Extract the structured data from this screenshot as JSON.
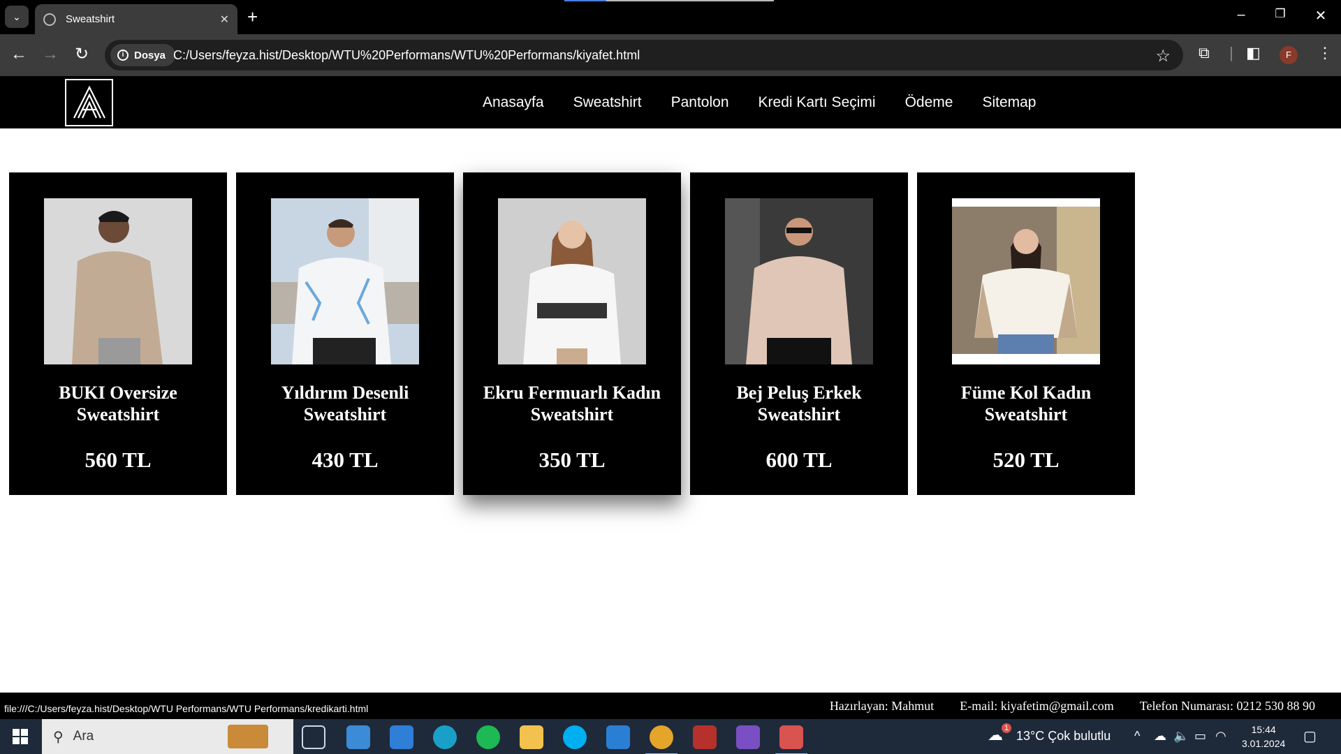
{
  "browser": {
    "tab_title": "Sweatshirt",
    "site_label": "Dosya",
    "url": "C:/Users/feyza.hist/Desktop/WTU%20Performans/WTU%20Performans/kiyafet.html",
    "profile_initial": "F"
  },
  "site": {
    "nav": [
      "Anasayfa",
      "Sweatshirt",
      "Pantolon",
      "Kredi Kartı Seçimi",
      "Ödeme",
      "Sitemap"
    ]
  },
  "products": [
    {
      "name": "BUKI Oversize Sweatshirt",
      "price": "560 TL"
    },
    {
      "name": "Yıldırım Desenli Sweatshirt",
      "price": "430 TL"
    },
    {
      "name": "Ekru Fermuarlı Kadın Sweatshirt",
      "price": "350 TL"
    },
    {
      "name": "Bej Peluş Erkek Sweatshirt",
      "price": "600 TL"
    },
    {
      "name": "Füme Kol Kadın Sweatshirt",
      "price": "520 TL"
    }
  ],
  "footer": {
    "author": "Hazırlayan: Mahmut",
    "email": "E-mail: kiyafetim@gmail.com",
    "phone": "Telefon Numarası: 0212 530 88 90"
  },
  "status_url": "file:///C:/Users/feyza.hist/Desktop/WTU Performans/WTU Performans/kredikarti.html",
  "taskbar": {
    "search_placeholder": "Ara",
    "weather": "13°C  Çok bulutlu",
    "weather_badge": "1",
    "time": "15:44",
    "date": "3.01.2024"
  }
}
